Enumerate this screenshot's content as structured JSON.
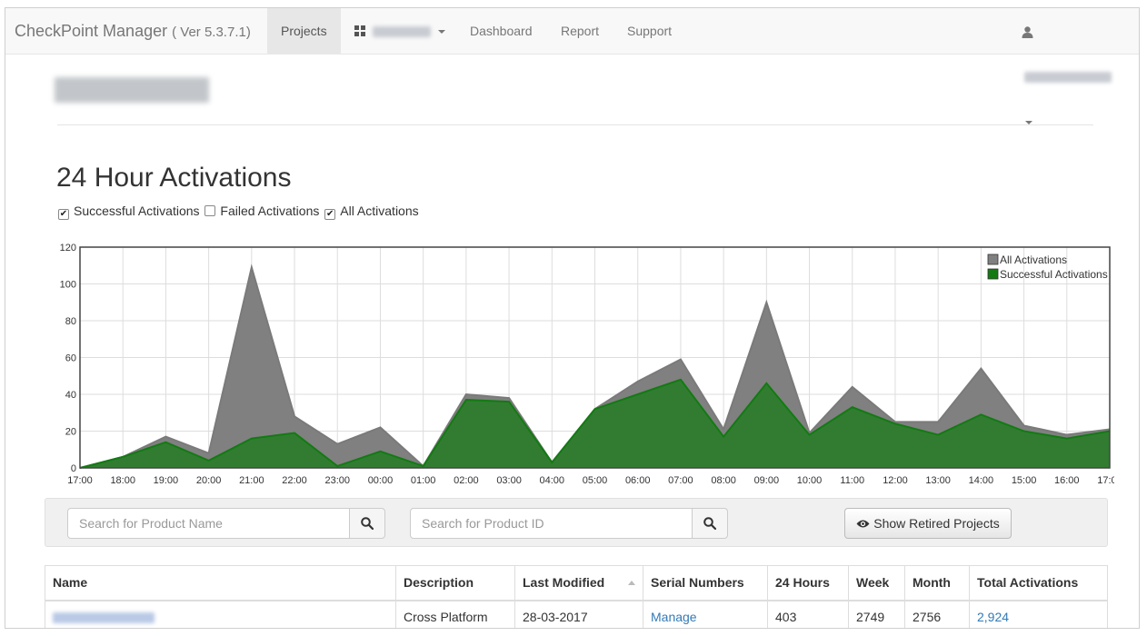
{
  "navbar": {
    "brand": "CheckPoint Manager",
    "version": "( Ver 5.3.7.1)",
    "projects_label": "Projects",
    "dashboard_label": "Dashboard",
    "report_label": "Report",
    "support_label": "Support"
  },
  "section_title": "24 Hour Activations",
  "filters": {
    "successful": {
      "label": "Successful Activations",
      "checked": true
    },
    "failed": {
      "label": "Failed Activations",
      "checked": false
    },
    "all": {
      "label": "All Activations",
      "checked": true
    }
  },
  "chart_data": {
    "type": "area",
    "title": "",
    "xlabel": "",
    "ylabel": "",
    "ylim": [
      0,
      120
    ],
    "yticks": [
      0,
      20,
      40,
      60,
      80,
      100,
      120
    ],
    "x": [
      "17:00",
      "18:00",
      "19:00",
      "20:00",
      "21:00",
      "22:00",
      "23:00",
      "00:00",
      "01:00",
      "02:00",
      "03:00",
      "04:00",
      "05:00",
      "06:00",
      "07:00",
      "08:00",
      "09:00",
      "10:00",
      "11:00",
      "12:00",
      "13:00",
      "14:00",
      "15:00",
      "16:00",
      "17:00"
    ],
    "series": [
      {
        "name": "All Activations",
        "color": "#808080",
        "values": [
          0,
          6,
          17,
          8,
          109,
          28,
          13,
          22,
          1,
          40,
          38,
          3,
          32,
          47,
          59,
          21,
          90,
          19,
          44,
          25,
          25,
          54,
          23,
          18,
          21
        ]
      },
      {
        "name": "Successful Activations",
        "color": "#137a13",
        "values": [
          0,
          6,
          14,
          4,
          16,
          19,
          1,
          9,
          1,
          37,
          36,
          3,
          32,
          40,
          48,
          17,
          46,
          18,
          33,
          24,
          18,
          29,
          20,
          16,
          20
        ]
      }
    ],
    "grid": true,
    "legend": "top-right"
  },
  "search": {
    "product_name_placeholder": "Search for Product Name",
    "product_id_placeholder": "Search for Product ID",
    "retired_label": "Show Retired Projects"
  },
  "table": {
    "headers": [
      "Name",
      "Description",
      "Last Modified",
      "Serial Numbers",
      "24 Hours",
      "Week",
      "Month",
      "Total Activations"
    ],
    "rows": [
      {
        "description": "Cross Platform",
        "last_modified": "28-03-2017",
        "serial_numbers": "Manage",
        "h24": "403",
        "week": "2749",
        "month": "2756",
        "total": "2,924"
      }
    ]
  }
}
